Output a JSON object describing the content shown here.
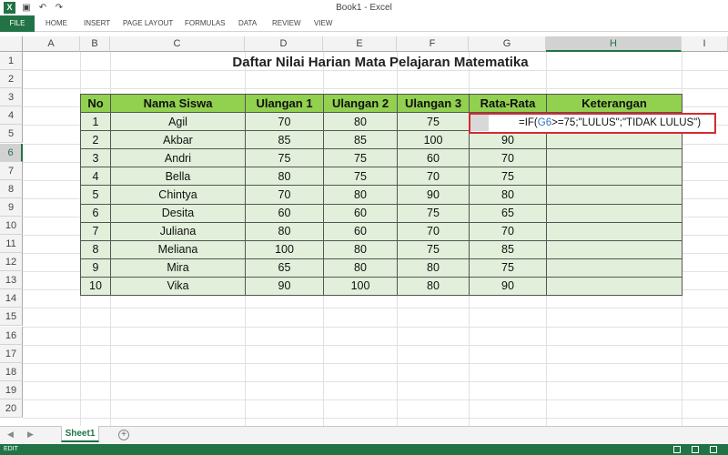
{
  "window": {
    "title": "Book1 - Excel"
  },
  "ribbon": {
    "tabs": [
      "FILE",
      "HOME",
      "INSERT",
      "PAGE LAYOUT",
      "FORMULAS",
      "DATA",
      "REVIEW",
      "VIEW"
    ]
  },
  "columns": [
    "A",
    "B",
    "C",
    "D",
    "E",
    "F",
    "G",
    "H",
    "I"
  ],
  "rows": [
    "1",
    "2",
    "3",
    "4",
    "5",
    "6",
    "7",
    "8",
    "9",
    "10",
    "11",
    "12",
    "13",
    "14",
    "15",
    "16",
    "17",
    "18",
    "19",
    "20"
  ],
  "sheet": {
    "title": "Daftar Nilai Harian Mata Pelajaran Matematika",
    "headers": [
      "No",
      "Nama Siswa",
      "Ulangan 1",
      "Ulangan 2",
      "Ulangan 3",
      "Rata-Rata",
      "Keterangan"
    ],
    "rows": [
      [
        "1",
        "Agil",
        "70",
        "80",
        "75",
        "",
        ""
      ],
      [
        "2",
        "Akbar",
        "85",
        "85",
        "100",
        "90",
        ""
      ],
      [
        "3",
        "Andri",
        "75",
        "75",
        "60",
        "70",
        ""
      ],
      [
        "4",
        "Bella",
        "80",
        "75",
        "70",
        "75",
        ""
      ],
      [
        "5",
        "Chintya",
        "70",
        "80",
        "90",
        "80",
        ""
      ],
      [
        "6",
        "Desita",
        "60",
        "60",
        "75",
        "65",
        ""
      ],
      [
        "7",
        "Juliana",
        "80",
        "60",
        "70",
        "70",
        ""
      ],
      [
        "8",
        "Meliana",
        "100",
        "80",
        "75",
        "85",
        ""
      ],
      [
        "9",
        "Mira",
        "65",
        "80",
        "80",
        "75",
        ""
      ],
      [
        "10",
        "Vika",
        "90",
        "100",
        "80",
        "90",
        ""
      ]
    ],
    "formula": {
      "prefix": "=IF(",
      "ref": "G6",
      "suffix": ">=75;\"LULUS\";\"TIDAK LULUS\")"
    }
  },
  "sheet_tabs": {
    "active": "Sheet1",
    "add_label": "+"
  },
  "status": {
    "mode": "EDIT"
  },
  "colors": {
    "excel_green": "#217346",
    "header_fill": "#92d050",
    "cell_fill": "#e2efda",
    "highlight": "#d9282f"
  }
}
